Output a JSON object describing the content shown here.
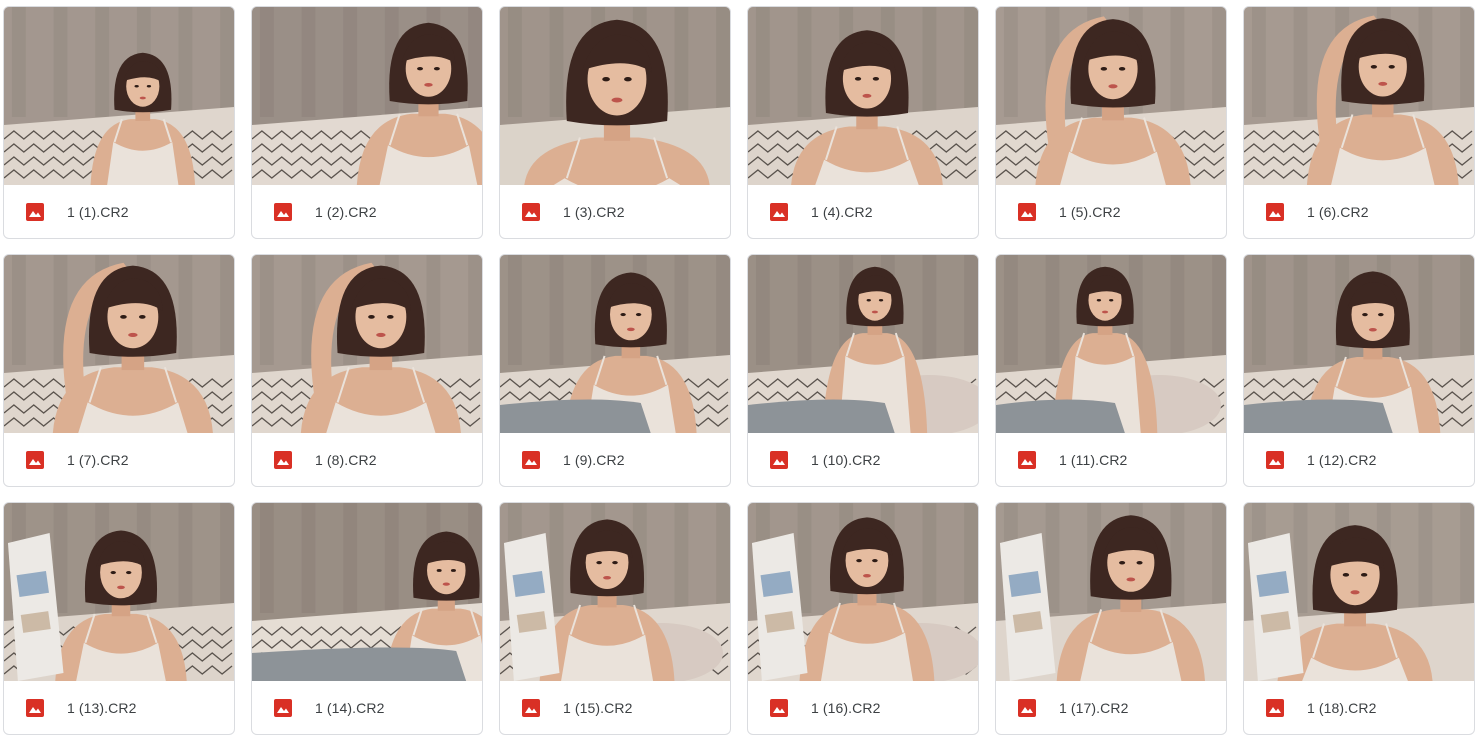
{
  "colors": {
    "image_icon": "#d93025",
    "card_border": "#dadce0",
    "filename_text": "#3c4043"
  },
  "file_icon": "image-file-icon",
  "files": [
    {
      "name": "1 (1).CR2",
      "scene": {
        "bg": "#a69d96",
        "floor": "#e6e0d8",
        "pattern": true,
        "jeans": false,
        "pillow": false,
        "magazine": false,
        "arm_up": false
      }
    },
    {
      "name": "1 (2).CR2",
      "scene": {
        "bg": "#9d948e",
        "floor": "#e9e3dc",
        "pattern": true,
        "jeans": false,
        "pillow": false,
        "magazine": false,
        "arm_up": false
      }
    },
    {
      "name": "1 (3).CR2",
      "scene": {
        "bg": "#a39a92",
        "floor": "#e2dcd4",
        "pattern": false,
        "jeans": false,
        "pillow": false,
        "magazine": false,
        "arm_up": false
      }
    },
    {
      "name": "1 (4).CR2",
      "scene": {
        "bg": "#a49b93",
        "floor": "#e4ded6",
        "pattern": true,
        "jeans": false,
        "pillow": false,
        "magazine": false,
        "arm_up": false
      }
    },
    {
      "name": "1 (5).CR2",
      "scene": {
        "bg": "#aaa199",
        "floor": "#e8e2da",
        "pattern": true,
        "jeans": false,
        "pillow": false,
        "magazine": false,
        "arm_up": true
      }
    },
    {
      "name": "1 (6).CR2",
      "scene": {
        "bg": "#a9a098",
        "floor": "#e8e2da",
        "pattern": true,
        "jeans": false,
        "pillow": false,
        "magazine": false,
        "arm_up": true
      }
    },
    {
      "name": "1 (7).CR2",
      "scene": {
        "bg": "#a79e96",
        "floor": "#e6e0d8",
        "pattern": true,
        "jeans": false,
        "pillow": false,
        "magazine": false,
        "arm_up": true
      }
    },
    {
      "name": "1 (8).CR2",
      "scene": {
        "bg": "#a89f97",
        "floor": "#e7e1d9",
        "pattern": true,
        "jeans": false,
        "pillow": false,
        "magazine": false,
        "arm_up": true
      }
    },
    {
      "name": "1 (9).CR2",
      "scene": {
        "bg": "#a0978f",
        "floor": "#e6e0d8",
        "pattern": true,
        "jeans": true,
        "pillow": false,
        "magazine": false,
        "arm_up": false
      }
    },
    {
      "name": "1 (10).CR2",
      "scene": {
        "bg": "#9e958d",
        "floor": "#e8e2da",
        "pattern": true,
        "jeans": true,
        "pillow": true,
        "magazine": false,
        "arm_up": false
      }
    },
    {
      "name": "1 (11).CR2",
      "scene": {
        "bg": "#9f968e",
        "floor": "#e8e2da",
        "pattern": true,
        "jeans": true,
        "pillow": true,
        "magazine": false,
        "arm_up": false
      }
    },
    {
      "name": "1 (12).CR2",
      "scene": {
        "bg": "#a39a92",
        "floor": "#e6e0d8",
        "pattern": true,
        "jeans": true,
        "pillow": false,
        "magazine": false,
        "arm_up": false
      }
    },
    {
      "name": "1 (13).CR2",
      "scene": {
        "bg": "#a19890",
        "floor": "#e4ded6",
        "pattern": true,
        "jeans": false,
        "pillow": false,
        "magazine": true,
        "arm_up": false
      }
    },
    {
      "name": "1 (14).CR2",
      "scene": {
        "bg": "#9c938b",
        "floor": "#ece7e0",
        "pattern": true,
        "jeans": true,
        "pillow": true,
        "magazine": false,
        "arm_up": false
      }
    },
    {
      "name": "1 (15).CR2",
      "scene": {
        "bg": "#a69d95",
        "floor": "#e7e1d9",
        "pattern": true,
        "jeans": false,
        "pillow": true,
        "magazine": true,
        "arm_up": false
      }
    },
    {
      "name": "1 (16).CR2",
      "scene": {
        "bg": "#a59c94",
        "floor": "#e7e1d9",
        "pattern": true,
        "jeans": false,
        "pillow": true,
        "magazine": true,
        "arm_up": false
      }
    },
    {
      "name": "1 (17).CR2",
      "scene": {
        "bg": "#a8a098",
        "floor": "#e5dfd7",
        "pattern": false,
        "jeans": false,
        "pillow": false,
        "magazine": true,
        "arm_up": false
      }
    },
    {
      "name": "1 (18).CR2",
      "scene": {
        "bg": "#aaa29a",
        "floor": "#e5dfd7",
        "pattern": false,
        "jeans": false,
        "pillow": false,
        "magazine": true,
        "arm_up": false
      }
    }
  ]
}
